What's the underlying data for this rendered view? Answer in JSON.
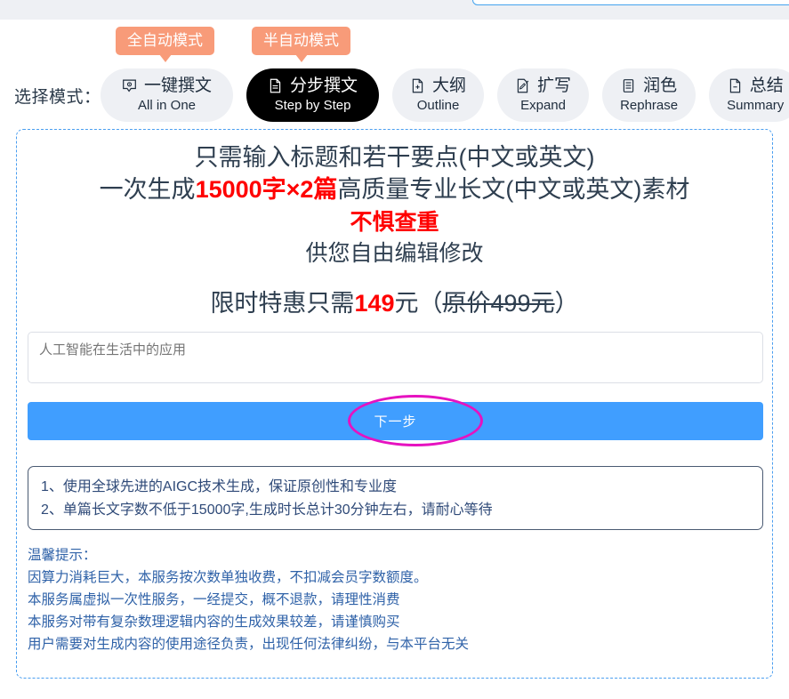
{
  "top_panel": {
    "visible_stub": true
  },
  "mode_selector": {
    "label": "选择模式：",
    "badges": [
      {
        "id": "auto",
        "text": "全自动模式"
      },
      {
        "id": "semi",
        "text": "半自动模式"
      }
    ],
    "items": [
      {
        "cn": "一键撰文",
        "en": "All in One",
        "icon": "chat-gear-icon",
        "active": false
      },
      {
        "cn": "分步撰文",
        "en": "Step by Step",
        "icon": "document-lines-icon",
        "active": true
      },
      {
        "cn": "大纲",
        "en": "Outline",
        "icon": "document-plus-icon",
        "active": false
      },
      {
        "cn": "扩写",
        "en": "Expand",
        "icon": "document-edit-icon",
        "active": false
      },
      {
        "cn": "润色",
        "en": "Rephrase",
        "icon": "document-list-icon",
        "active": false
      },
      {
        "cn": "总结",
        "en": "Summary",
        "icon": "document-minus-icon",
        "active": false
      }
    ]
  },
  "promo": {
    "line1": "只需输入标题和若干要点(中文或英文)",
    "line2_prefix": "一次生成",
    "line2_highlight": "15000字×2篇",
    "line2_suffix": "高质量专业长文(中文或英文)素材",
    "line3": "不惧查重",
    "line4": "供您自由编辑修改",
    "price_prefix": "限时特惠只需",
    "price_value": "149",
    "price_unit": "元（",
    "price_original": "原价499元",
    "price_close": "）"
  },
  "topic_input": {
    "placeholder": "人工智能在生活中的应用",
    "value": ""
  },
  "next_button": {
    "label": "下一步",
    "color": "#409eff",
    "annotation": "magenta-ellipse-highlight"
  },
  "notes": {
    "items": [
      "1、使用全球先进的AIGC技术生成，保证原创性和专业度",
      "2、单篇长文字数不低于15000字,生成时长总计30分钟左右，请耐心等待"
    ]
  },
  "tips": {
    "title": "温馨提示：",
    "lines": [
      "因算力消耗巨大，本服务按次数单独收费，不扣减会员字数额度。",
      "本服务属虚拟一次性服务，一经提交，概不退款，请理性消费",
      "本服务对带有复杂数理逻辑内容的生成效果较差，请谨慎购买",
      "用户需要对生成内容的使用途径负责，出现任何法律纠纷，与本平台无关"
    ]
  },
  "colors": {
    "badge": "#f89b79",
    "accent_blue": "#409eff",
    "highlight_red": "#ff0000",
    "annotation_magenta": "#e612c0",
    "card_border": "#4a9ef0"
  }
}
